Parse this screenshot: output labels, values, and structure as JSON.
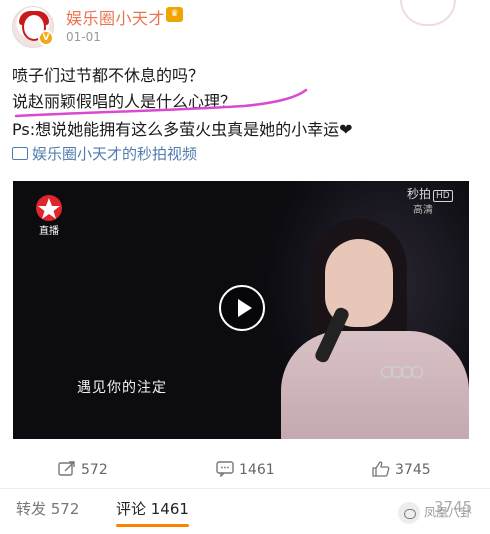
{
  "post": {
    "username": "娱乐圈小天才",
    "timestamp": "01-01",
    "lines": [
      "喷子们过节都不休息的吗？",
      "说赵丽颖假唱的人是什么心理？",
      "Ps:想说她能拥有这么多萤火虫真是她的小幸运❤"
    ],
    "video_link": "娱乐圈小天才的秒拍视频"
  },
  "video": {
    "channel_logo_text": "直播",
    "watermark": "秒拍",
    "hd_label": "HD",
    "watermark_sub": "高清",
    "subtitle": "遇见你的注定"
  },
  "actions": {
    "forward_count": "572",
    "comment_count": "1461",
    "like_count": "3745"
  },
  "tabs": {
    "forward": "转发 572",
    "comment": "评论 1461",
    "like": "3745"
  },
  "overlay": {
    "bottom_watermark": "凤凰八卦"
  },
  "colors": {
    "username": "#eb7350",
    "link": "#507daf",
    "highlight_stroke": "#d84bd0",
    "tab_indicator": "#ff8200"
  }
}
